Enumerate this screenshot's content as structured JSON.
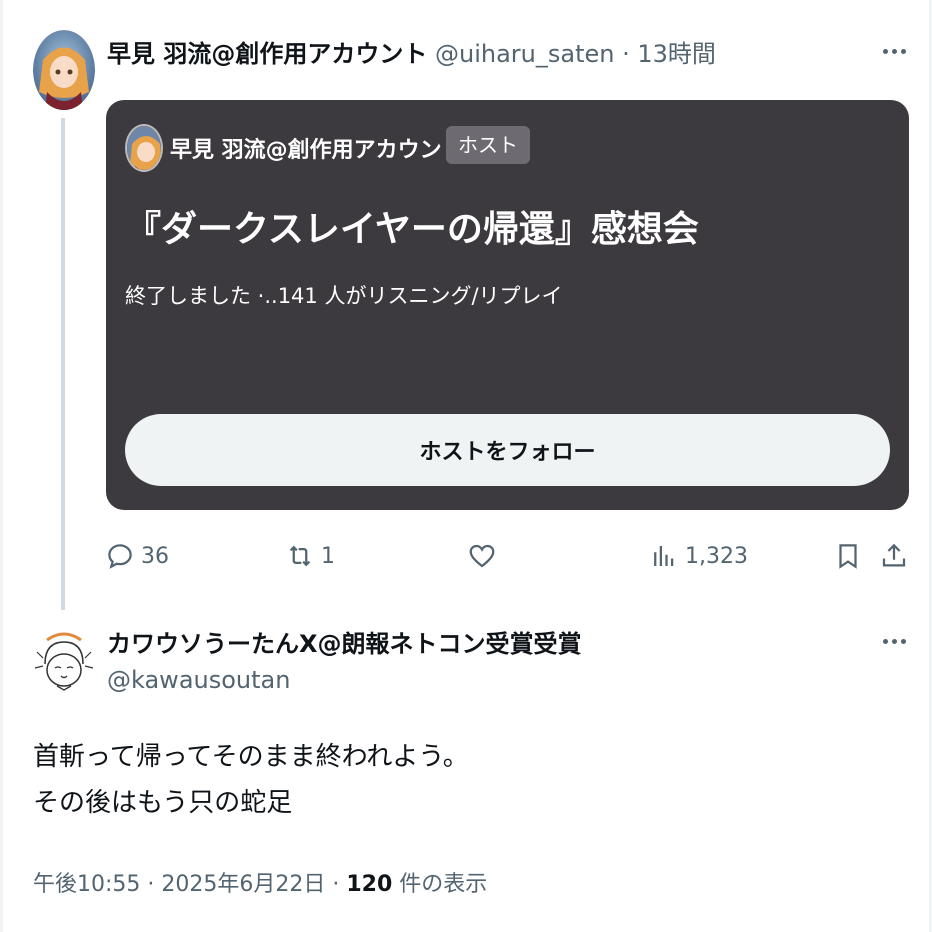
{
  "tweet1": {
    "author_name": "早見 羽流@創作用アカウント",
    "handle": "@uiharu_saten",
    "separator": " · ",
    "time": "13時間",
    "more_icon": "more-horizontal-icon"
  },
  "space_card": {
    "host_name": "早見 羽流@創作用アカウント",
    "host_badge": "ホスト",
    "title": "『ダークスレイヤーの帰還』感想会",
    "status": "終了しました ·..141 人がリスニング/リプレイ",
    "follow_button": "ホストをフォロー",
    "background_color": "#3d3a3f"
  },
  "actions": {
    "reply_count": "36",
    "retweet_count": "1",
    "like_count": "",
    "views_count": "1,323"
  },
  "tweet2": {
    "author_name": "カワウソうーたんX@朗報ネトコン受賞受賞",
    "handle": "@kawausoutan",
    "body_line1": "首斬って帰ってそのまま終われよう。",
    "body_line2": "その後はもう只の蛇足",
    "timestamp": "午後10:55 · 2025年6月22日 · ",
    "view_count": "120",
    "view_suffix": " 件の表示"
  },
  "colors": {
    "text_primary": "#0f1419",
    "text_muted": "#536471",
    "thread_line": "#cfd9de"
  }
}
